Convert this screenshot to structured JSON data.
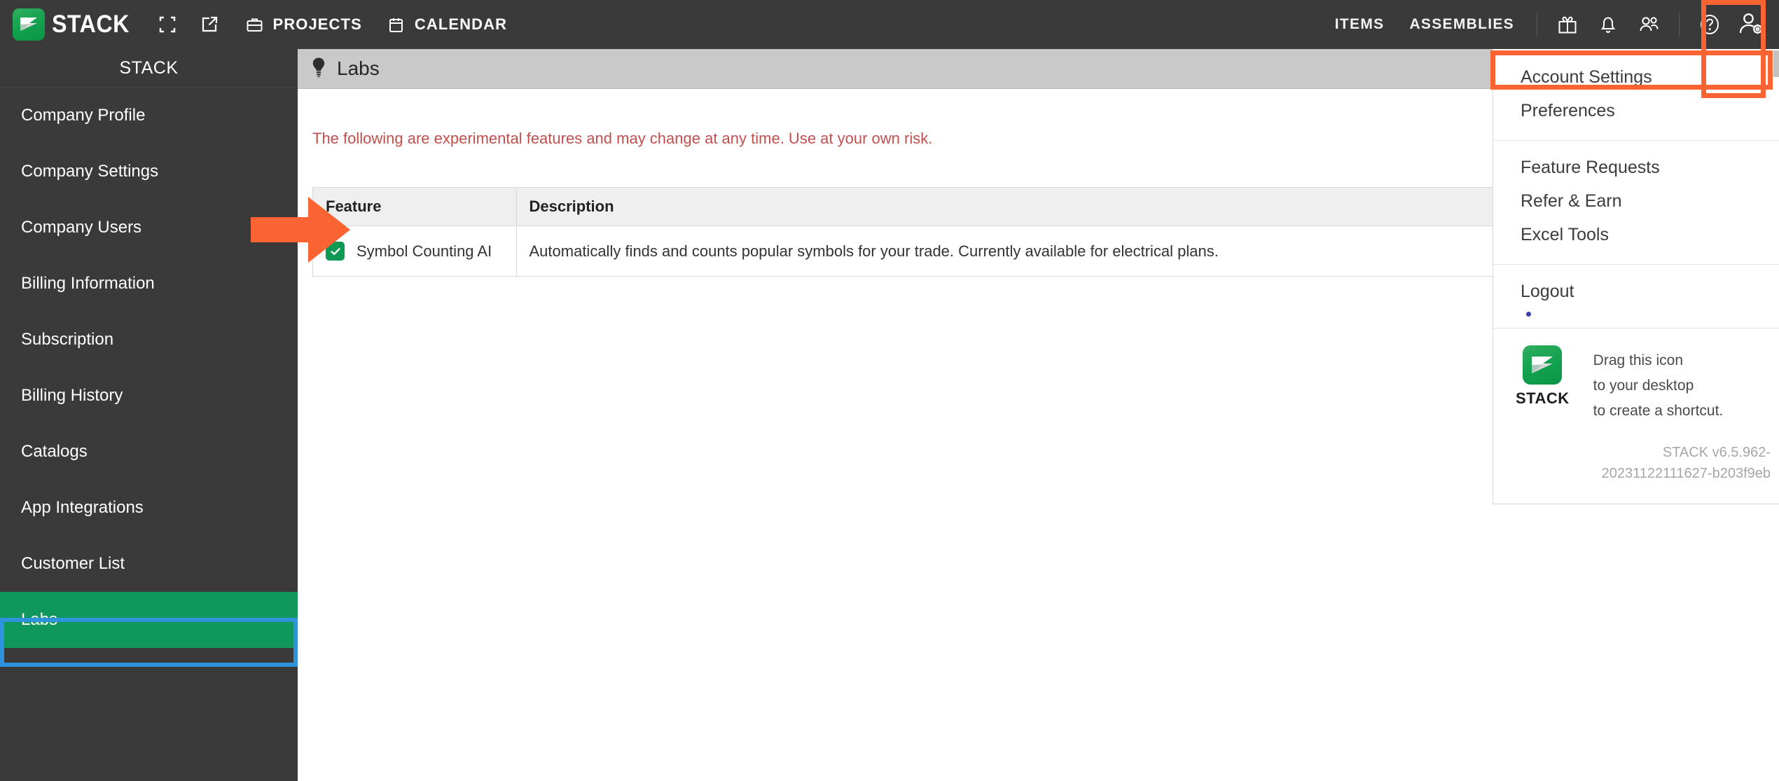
{
  "topbar": {
    "brand": "STACK",
    "logo_icon": "stack-logo-icon",
    "expand_icon": "expand-fullscreen-icon",
    "popout_icon": "open-external-icon",
    "projects": {
      "label": "PROJECTS",
      "icon": "briefcase-icon"
    },
    "calendar": {
      "label": "CALENDAR",
      "icon": "calendar-icon"
    },
    "items_label": "ITEMS",
    "assemblies_label": "ASSEMBLIES",
    "gift_icon": "gift-icon",
    "bell_icon": "bell-notification-icon",
    "people_icon": "people-icon",
    "help_icon": "help-circle-icon",
    "account_icon": "account-settings-person-gear-icon"
  },
  "sidebar": {
    "title": "STACK",
    "items": [
      {
        "label": "Company Profile"
      },
      {
        "label": "Company Settings"
      },
      {
        "label": "Company Users"
      },
      {
        "label": "Billing Information"
      },
      {
        "label": "Subscription"
      },
      {
        "label": "Billing History"
      },
      {
        "label": "Catalogs"
      },
      {
        "label": "App Integrations"
      },
      {
        "label": "Customer List"
      },
      {
        "label": "Labs"
      }
    ],
    "active_index": 9
  },
  "main": {
    "page_title": "Labs",
    "page_title_icon": "lightbulb-icon",
    "warning": "The following are experimental features and may change at any time. Use at your own risk.",
    "table": {
      "columns": [
        "Feature",
        "Description"
      ],
      "rows": [
        {
          "checked": true,
          "feature": "Symbol Counting AI",
          "description": "Automatically finds and counts popular symbols for your trade. Currently available for electrical plans."
        }
      ]
    }
  },
  "menu": {
    "items_top": [
      "Account Settings",
      "Preferences"
    ],
    "items_mid": [
      "Feature Requests",
      "Refer & Earn",
      "Excel Tools"
    ],
    "logout": "Logout",
    "shortcut": {
      "logo_icon": "stack-logo-icon",
      "name": "STACK",
      "line1": "Drag this icon",
      "line2": "to your desktop",
      "line3": "to create a shortcut."
    },
    "version_line1": "STACK v6.5.962-",
    "version_line2": "20231122111627-b203f9eb"
  },
  "annotations": {
    "arrow_icon": "orange-pointer-arrow",
    "highlight_color": "#fa6432",
    "labs_highlight_color": "#2f92dd"
  },
  "colors": {
    "header_bg": "#3a3a3a",
    "accent_green": "#10985c",
    "warning_red": "#c0504d",
    "orange": "#fa6432",
    "blue": "#2f92dd"
  }
}
